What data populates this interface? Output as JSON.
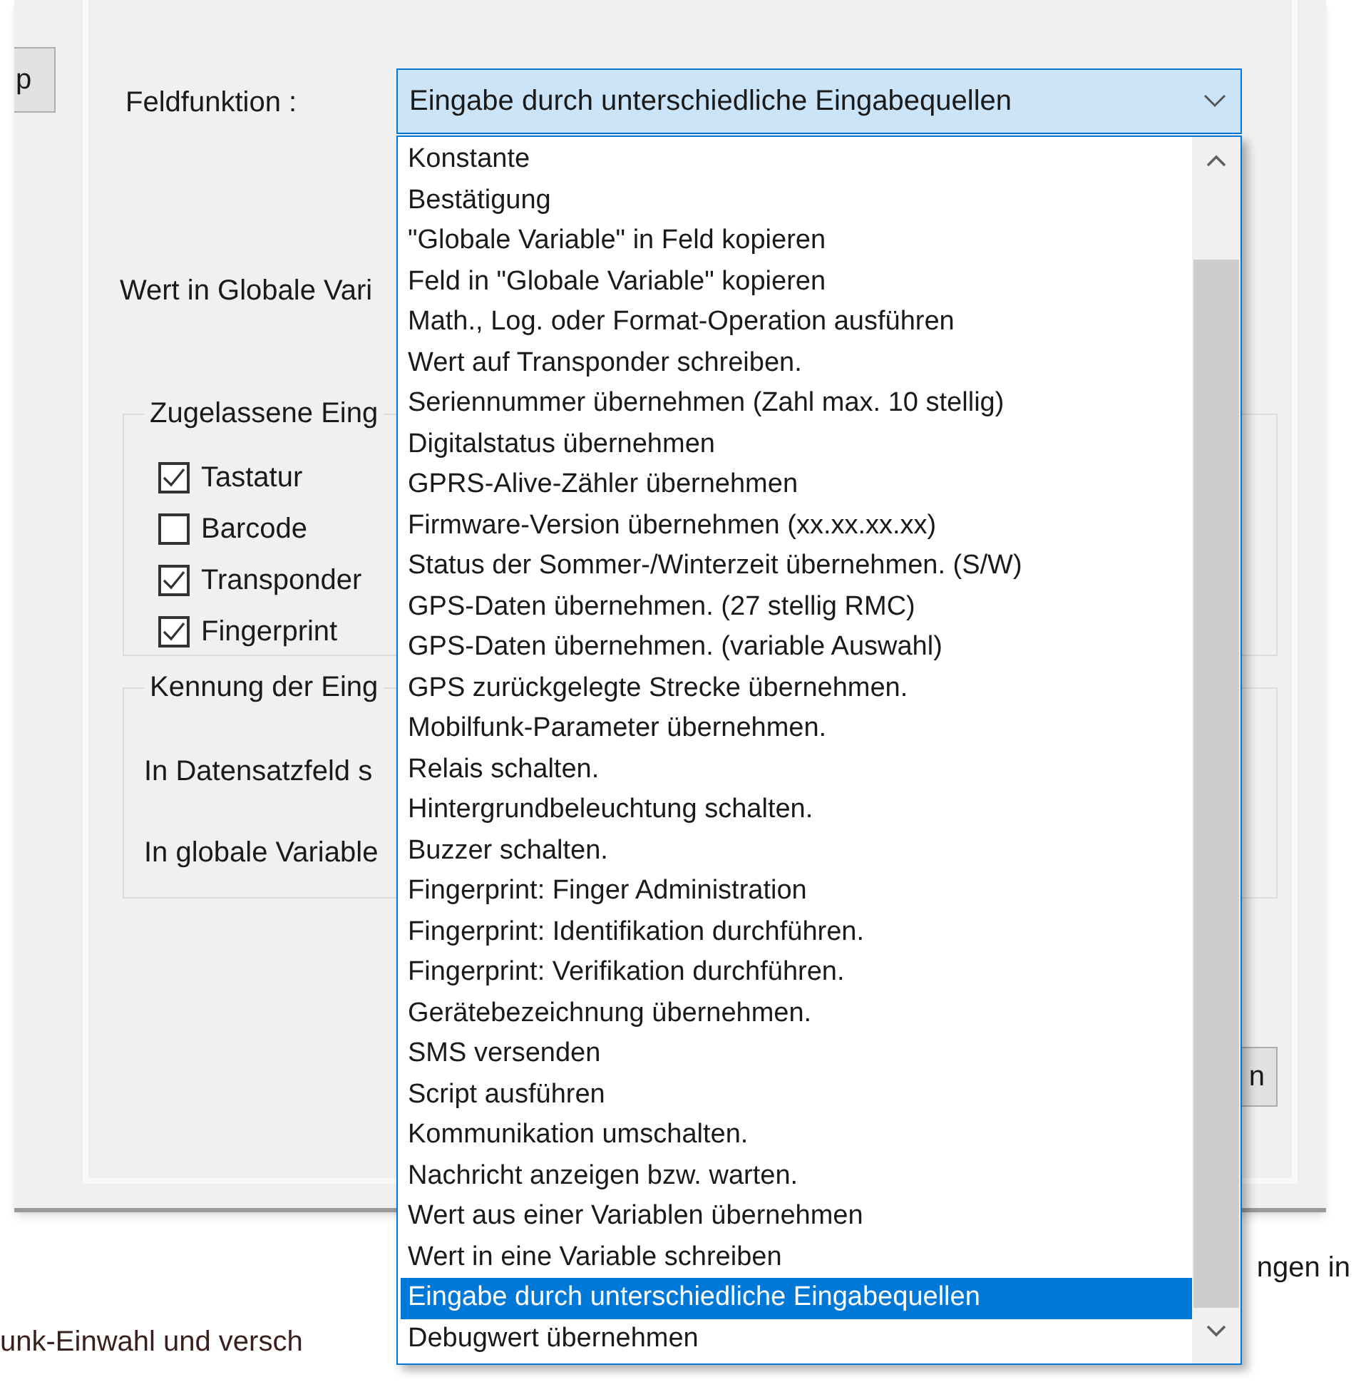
{
  "side_button": {
    "label": "p"
  },
  "field_function": {
    "label": "Feldfunktion :",
    "value": "Eingabe durch unterschiedliche Eingabequellen"
  },
  "global_variable_label": "Wert in Globale Vari",
  "input_sources": {
    "title": "Zugelassene Eing",
    "items": [
      {
        "label": "Tastatur",
        "checked": true
      },
      {
        "label": "Barcode",
        "checked": false
      },
      {
        "label": "Transponder",
        "checked": true
      },
      {
        "label": "Fingerprint",
        "checked": true
      }
    ]
  },
  "identification": {
    "title": "Kennung der Eing",
    "labels": [
      "In Datensatzfeld s",
      "In globale Variable"
    ]
  },
  "partial_button": {
    "label": "n"
  },
  "dropdown_items": [
    {
      "label": "Konstante",
      "selected": false
    },
    {
      "label": "Bestätigung",
      "selected": false
    },
    {
      "label": "\"Globale Variable\" in Feld kopieren",
      "selected": false
    },
    {
      "label": "Feld in \"Globale Variable\" kopieren",
      "selected": false
    },
    {
      "label": "Math., Log. oder Format-Operation ausführen",
      "selected": false
    },
    {
      "label": "Wert auf Transponder schreiben.",
      "selected": false
    },
    {
      "label": "Seriennummer übernehmen (Zahl max. 10 stellig)",
      "selected": false
    },
    {
      "label": "Digitalstatus übernehmen",
      "selected": false
    },
    {
      "label": "GPRS-Alive-Zähler übernehmen",
      "selected": false
    },
    {
      "label": "Firmware-Version übernehmen (xx.xx.xx.xx)",
      "selected": false
    },
    {
      "label": "Status der Sommer-/Winterzeit übernehmen. (S/W)",
      "selected": false
    },
    {
      "label": "GPS-Daten übernehmen. (27 stellig RMC)",
      "selected": false
    },
    {
      "label": "GPS-Daten übernehmen. (variable Auswahl)",
      "selected": false
    },
    {
      "label": "GPS zurückgelegte Strecke übernehmen.",
      "selected": false
    },
    {
      "label": "Mobilfunk-Parameter übernehmen.",
      "selected": false
    },
    {
      "label": "Relais schalten.",
      "selected": false
    },
    {
      "label": "Hintergrundbeleuchtung schalten.",
      "selected": false
    },
    {
      "label": "Buzzer schalten.",
      "selected": false
    },
    {
      "label": "Fingerprint: Finger Administration",
      "selected": false
    },
    {
      "label": "Fingerprint: Identifikation durchführen.",
      "selected": false
    },
    {
      "label": "Fingerprint: Verifikation durchführen.",
      "selected": false
    },
    {
      "label": "Gerätebezeichnung übernehmen.",
      "selected": false
    },
    {
      "label": "SMS versenden",
      "selected": false
    },
    {
      "label": "Script ausführen",
      "selected": false
    },
    {
      "label": "Kommunikation umschalten.",
      "selected": false
    },
    {
      "label": "Nachricht anzeigen bzw. warten.",
      "selected": false
    },
    {
      "label": "Wert aus einer Variablen übernehmen",
      "selected": false
    },
    {
      "label": "Wert in eine Variable schreiben",
      "selected": false
    },
    {
      "label": "Eingabe durch unterschiedliche Eingabequellen",
      "selected": true
    },
    {
      "label": "Debugwert übernehmen",
      "selected": false
    }
  ],
  "background_texts": {
    "right": "ngen in",
    "bottom": "unk-Einwahl und versch"
  }
}
